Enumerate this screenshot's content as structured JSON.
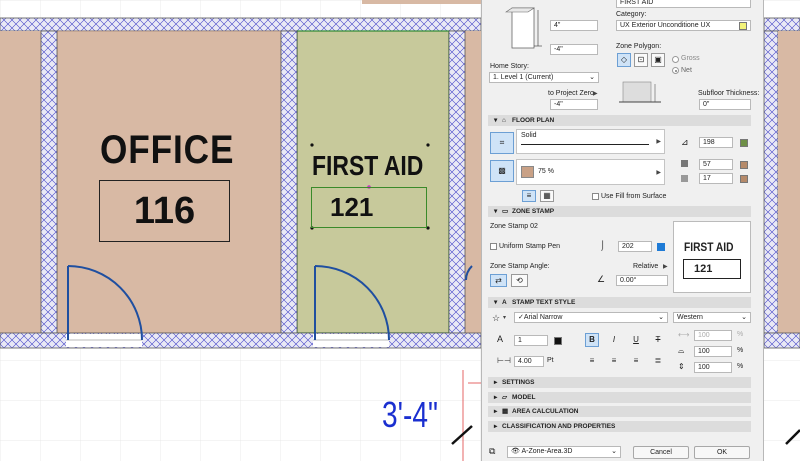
{
  "colors": {
    "room_office": "#d8b9a4",
    "room_firstaid": "#c7c99b",
    "wall_fill": "#b7b7b7",
    "hatch": "#3a3ad0",
    "door": "#1f4fa0",
    "dimension": "#1a2fd0",
    "accent_blue": "#1f7bd6"
  },
  "plan": {
    "office_name": "OFFICE",
    "office_number": "116",
    "firstaid_name": "FIRST AID",
    "firstaid_number": "121",
    "dimension_text": "3'-4\""
  },
  "panel": {
    "name_value": "FIRST AID",
    "category_label": "Category:",
    "category_value": "UX  Exterior Unconditione UX",
    "height_value": "4\"",
    "offset_value": "-4\"",
    "zone_polygon_label": "Zone Polygon:",
    "gross_label": "Gross",
    "net_label": "Net",
    "home_story_label": "Home Story:",
    "home_story_value": "1. Level 1 (Current)",
    "to_project_zero_label": "to Project Zero",
    "to_project_zero_value": "-4\"",
    "subfloor_label": "Subfloor Thickness:",
    "subfloor_value": "0\"",
    "floor_plan": {
      "title": "FLOOR PLAN",
      "line_type": "Solid",
      "pen_1": "198",
      "fill_percent": "75 %",
      "pen_2": "57",
      "pen_3": "17",
      "use_fill_label": "Use Fill from Surface"
    },
    "zone_stamp": {
      "title": "ZONE STAMP",
      "stamp_name": "Zone Stamp 02",
      "uniform_pen_label": "Uniform Stamp Pen",
      "pen_value": "202",
      "angle_label": "Zone Stamp Angle:",
      "relative_label": "Relative",
      "angle_value": "0.00°",
      "preview_name": "FIRST AID",
      "preview_number": "121"
    },
    "stamp_text_style": {
      "title": "STAMP TEXT STYLE",
      "font_name": "Arial Narrow",
      "script": "Western",
      "pen_value": "1",
      "width_percent": "100",
      "spacing_percent": "100",
      "height_percent": "100",
      "size_value": "4.00",
      "size_unit": "Pt",
      "pct": "%"
    },
    "collapsed_sections": [
      "SETTINGS",
      "MODEL",
      "AREA CALCULATION",
      "CLASSIFICATION AND PROPERTIES"
    ],
    "footer": {
      "layer": "A-Zone-Area.3D",
      "cancel": "Cancel",
      "ok": "OK"
    }
  }
}
